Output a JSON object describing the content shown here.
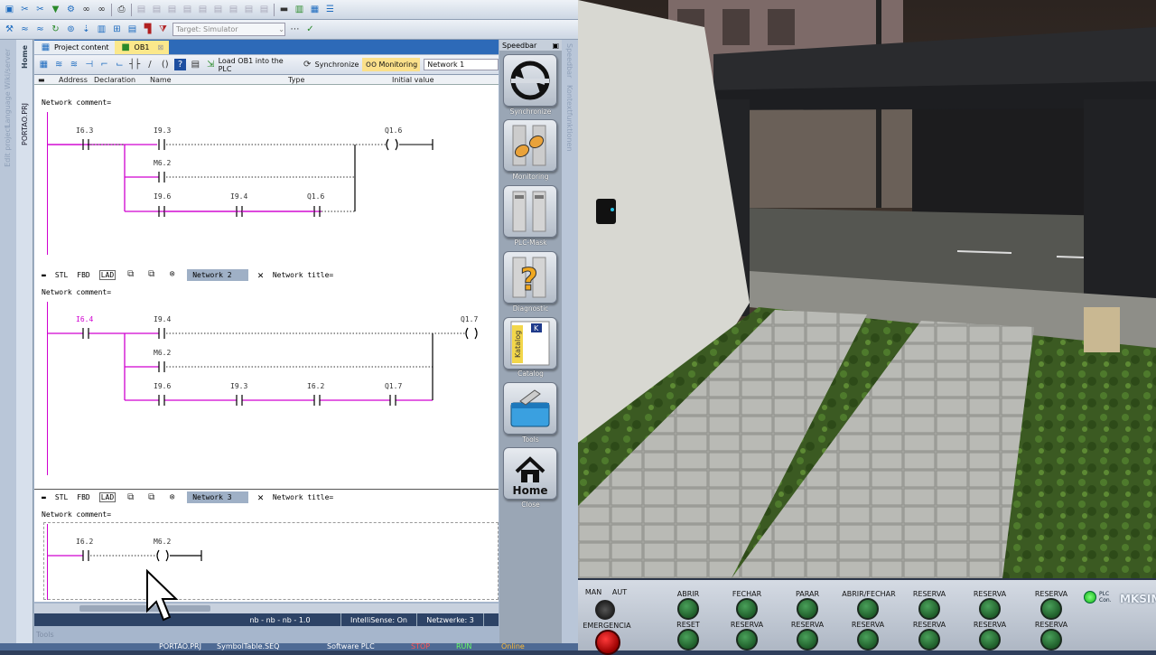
{
  "toolbar": {
    "target": "Target: Simulator"
  },
  "left_tabs": {
    "home": "Home",
    "project": "PORTAO.PRJ",
    "lang": "Language Wiki/server",
    "edit": "Edit project"
  },
  "doc_tabs": [
    {
      "label": "Project content"
    },
    {
      "label": "OB1"
    }
  ],
  "editor_toolbar": {
    "load": "Load OB1 into the PLC",
    "sync": "Synchronize",
    "monitoring": "Monitoring",
    "network": "Network 1"
  },
  "declaration": {
    "c1": "Address",
    "c2": "Declaration",
    "c3": "Name",
    "c4": "Type",
    "c5": "Initial value"
  },
  "network_comment": "Network comment=",
  "net_header": {
    "stl": "STL",
    "fbd": "FBD",
    "lad": "LAD",
    "title": "Network title="
  },
  "networks": [
    {
      "label": "Network 1",
      "contacts": [
        "I6.3",
        "I9.3",
        "M6.2",
        "I9.6",
        "I9.4",
        "Q1.6"
      ],
      "coil": "Q1.6"
    },
    {
      "label": "Network 2",
      "contacts": [
        "I6.4",
        "I9.4",
        "M6.2",
        "I9.6",
        "I9.3",
        "I6.2",
        "Q1.7"
      ],
      "coil": "Q1.7"
    },
    {
      "label": "Network 3",
      "contacts": [
        "I6.2"
      ],
      "coil": "M6.2"
    }
  ],
  "status": {
    "pos": "nb - nb - nb - 1.0",
    "intellisense": "IntelliSense: On",
    "networks": "Netzwerke: 3",
    "tools": "Tools"
  },
  "taskbar": {
    "items": [
      "PORTAO.PRJ",
      "SymbolTable.SEQ",
      "Software PLC",
      "STOP",
      "RUN",
      "Online"
    ]
  },
  "speedbar": {
    "title": "Speedbar",
    "buttons": [
      "Synchronize",
      "Monitoring",
      "PLC-Mask",
      "Diagnostic",
      "Catalog",
      "Tools",
      "Close"
    ],
    "home": "Home",
    "catalog_word": "Katalog"
  },
  "right_tabs": {
    "a": "Speedbar",
    "b": "Kontextfunktionen"
  },
  "panel": {
    "man": "MAN",
    "aut": "AUT",
    "emergencia": "EMERGENCIA",
    "top": [
      "ABRIR",
      "FECHAR",
      "PARAR",
      "ABRIR/FECHAR",
      "RESERVA",
      "RESERVA",
      "RESERVA"
    ],
    "bottom": [
      "RESET",
      "RESERVA",
      "RESERVA",
      "RESERVA",
      "RESERVA",
      "RESERVA",
      "RESERVA"
    ],
    "plc": "PLC",
    "con": "Con.",
    "logo": "MKSIM"
  },
  "colors": {
    "rail": "#d000d0",
    "blue": "#2d6ab8"
  }
}
